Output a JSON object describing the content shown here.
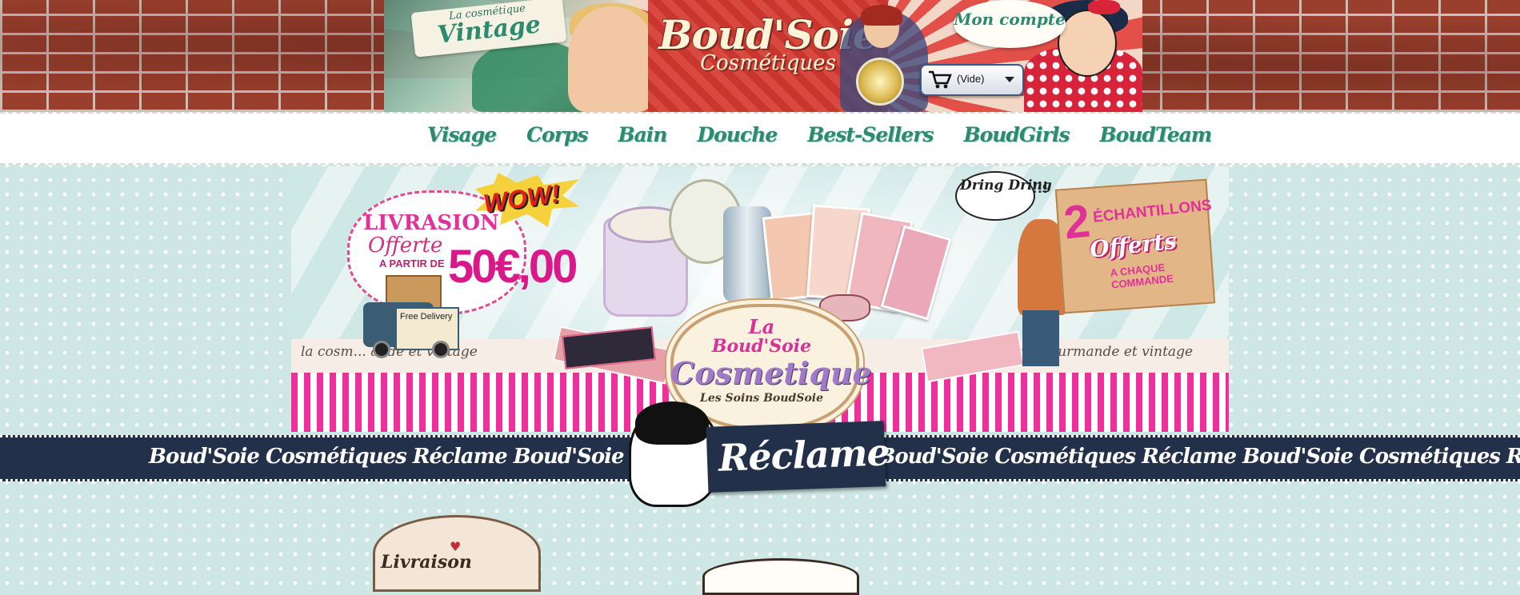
{
  "header": {
    "vintage_badge_small": "La cosmétique",
    "vintage_badge_big": "Vintage",
    "logo_title": "Boud'Soie",
    "logo_subtitle": "Cosmétiques",
    "account_label": "Mon compte",
    "cart_label": "(Vide)",
    "brand_colors": {
      "teal": "#2c8a6f",
      "brick": "#9a3f2e",
      "navy": "#22304a",
      "pink": "#e0309a"
    }
  },
  "nav": {
    "items": [
      "Visage",
      "Corps",
      "Bain",
      "Douche",
      "Best-Sellers",
      "BoudGirls",
      "BoudTeam"
    ]
  },
  "promo": {
    "wow": "WOW!",
    "livraison_line1": "LIVRASION",
    "livraison_line2": "Offerte",
    "livraison_line3": "A PARTIR DE",
    "livraison_amount": "50€,00",
    "truck_label": "Free Delivery",
    "tagline_left": "la cosm... ande et vintage",
    "tagline_right": "la cos... gourmande et vintage",
    "emblem_la": "La",
    "emblem_brand": "Boud'Soie",
    "emblem_cosmetique": "Cosmetique",
    "emblem_soins": "Les Soins BoudSoie",
    "dring_text": "Dring Dring",
    "dring_exclaim": "!!!",
    "samples_number": "2",
    "samples_label": "ÉCHANTILLONS",
    "samples_offerts": "Offerts",
    "samples_each_order": "A CHAQUE COMMANDE"
  },
  "band": {
    "repeat_text": "Boud'Soie Cosmétiques Réclame  Boud'Soie Cosmétiques Réclame  Boud'Soie Cosmétiques Réclame  Boud'Soie Cosmétiques Réclame",
    "tag": "Réclame"
  },
  "bottom": {
    "badge_text": "Livraison"
  }
}
